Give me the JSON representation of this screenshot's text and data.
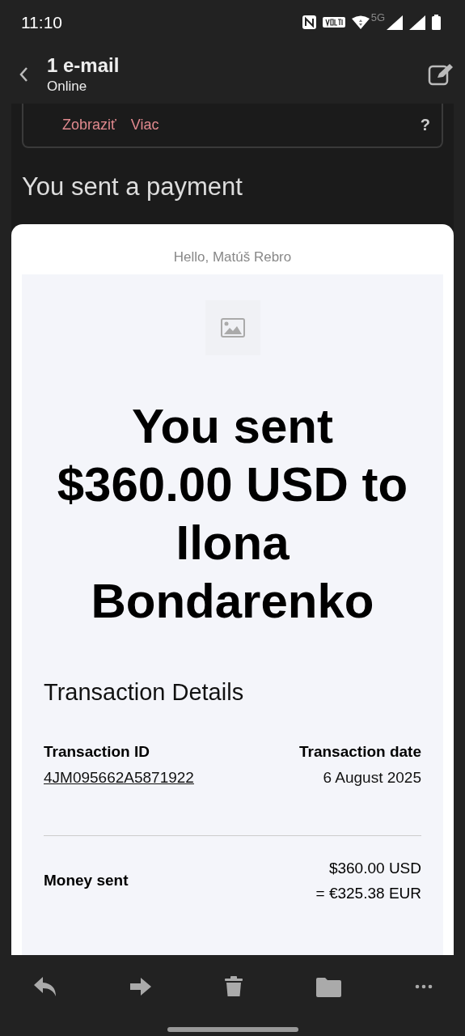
{
  "status_bar": {
    "time": "11:10",
    "network": "5G"
  },
  "header": {
    "title": "1 e-mail",
    "subtitle": "Online"
  },
  "previous_card": {
    "links": [
      "Zobraziť",
      "Viac"
    ],
    "help": "?"
  },
  "subject": "You sent a payment",
  "email": {
    "greeting": "Hello, Matúš Rebro",
    "headline": "You sent $360.00 USD to Ilona Bondarenko",
    "details_title": "Transaction Details",
    "fields": [
      {
        "label": "Transaction ID",
        "value": "4JM095662A5871922",
        "kind": "link"
      },
      {
        "label": "Transaction date",
        "value": "6 August 2025",
        "kind": "text"
      }
    ],
    "money_sent": {
      "label": "Money sent",
      "lines": [
        "$360.00 USD",
        "= €325.38 EUR"
      ]
    }
  }
}
